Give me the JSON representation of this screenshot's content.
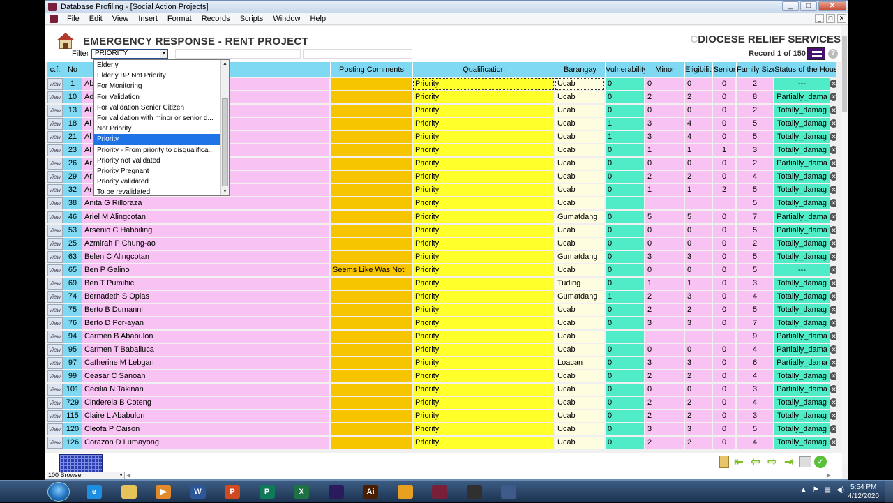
{
  "window": {
    "title": "Database Profiling - [Social Action Projects]",
    "min": "_",
    "max": "□",
    "close": "✕"
  },
  "menu": [
    "File",
    "Edit",
    "View",
    "Insert",
    "Format",
    "Records",
    "Scripts",
    "Window",
    "Help"
  ],
  "header": {
    "project_title": "EMERGENCY RESPONSE - RENT PROJECT",
    "org_prefix": "C",
    "org_name": "DIOCESE RELIEF SERVICES",
    "filter_label": "Filter",
    "filter_value": "PRIORITY",
    "record_info": "Record 1 of 150",
    "help": "?"
  },
  "columns": {
    "cf": "c.f.",
    "no": "No",
    "posting": "Posting Comments",
    "qual": "Qualification",
    "brgy": "Barangay",
    "vul": "Vulnerability",
    "minor": "Minor",
    "elig": "Eligibility",
    "senior": "Senior",
    "family": "Family Size",
    "status": "Status of the House"
  },
  "dropdown": {
    "selected": "Priority",
    "options": [
      "Elderly",
      "Elderly BP Not Priority",
      "For Monitoring",
      "For Validation",
      "For validation Senior Citizen",
      "For validation with minor or senior d...",
      "Not Priority",
      "Priority",
      "Priority - From priority to disqualifica...",
      "Priority not validated",
      "Priority Pregnant",
      "Priority validated",
      "To be revalidated"
    ]
  },
  "view_label": "View",
  "rows": [
    {
      "no": "1",
      "name": "Ab",
      "posting": "",
      "qual": "Priority",
      "brgy": "Ucab",
      "vul": "0",
      "minor": "0",
      "elig": "0",
      "senior": "0",
      "family": "2",
      "status": "---"
    },
    {
      "no": "10",
      "name": "Ad",
      "posting": "",
      "qual": "Priority",
      "brgy": "Ucab",
      "vul": "0",
      "minor": "2",
      "elig": "2",
      "senior": "0",
      "family": "8",
      "status": "Partially_dama"
    },
    {
      "no": "13",
      "name": "Al",
      "posting": "",
      "qual": "Priority",
      "brgy": "Ucab",
      "vul": "0",
      "minor": "0",
      "elig": "0",
      "senior": "0",
      "family": "2",
      "status": "Totally_damag"
    },
    {
      "no": "18",
      "name": "Al",
      "posting": "",
      "qual": "Priority",
      "brgy": "Ucab",
      "vul": "1",
      "minor": "3",
      "elig": "4",
      "senior": "0",
      "family": "5",
      "status": "Totally_damag"
    },
    {
      "no": "21",
      "name": "Al",
      "posting": "",
      "qual": "Priority",
      "brgy": "Ucab",
      "vul": "1",
      "minor": "3",
      "elig": "4",
      "senior": "0",
      "family": "5",
      "status": "Totally_damag"
    },
    {
      "no": "23",
      "name": "Al",
      "posting": "",
      "qual": "Priority",
      "brgy": "Ucab",
      "vul": "0",
      "minor": "1",
      "elig": "1",
      "senior": "1",
      "family": "3",
      "status": "Totally_damag"
    },
    {
      "no": "26",
      "name": "Ar",
      "posting": "",
      "qual": "Priority",
      "brgy": "Ucab",
      "vul": "0",
      "minor": "0",
      "elig": "0",
      "senior": "0",
      "family": "2",
      "status": "Partially_dama"
    },
    {
      "no": "29",
      "name": "Ar",
      "posting": "",
      "qual": "Priority",
      "brgy": "Ucab",
      "vul": "0",
      "minor": "2",
      "elig": "2",
      "senior": "0",
      "family": "4",
      "status": "Totally_damag"
    },
    {
      "no": "32",
      "name": "Ar",
      "posting": "",
      "qual": "Priority",
      "brgy": "Ucab",
      "vul": "0",
      "minor": "1",
      "elig": "1",
      "senior": "2",
      "family": "5",
      "status": "Totally_damag"
    },
    {
      "no": "38",
      "name": "Anita G Rilloraza",
      "posting": "",
      "qual": "Priority",
      "brgy": "Ucab",
      "vul": "",
      "minor": "",
      "elig": "",
      "senior": "",
      "family": "5",
      "status": "Totally_damag"
    },
    {
      "no": "46",
      "name": "Ariel M Alingcotan",
      "posting": "",
      "qual": "Priority",
      "brgy": "Gumatdang",
      "vul": "0",
      "minor": "5",
      "elig": "5",
      "senior": "0",
      "family": "7",
      "status": "Partially_dama"
    },
    {
      "no": "53",
      "name": "Arsenio C Habbiling",
      "posting": "",
      "qual": "Priority",
      "brgy": "Ucab",
      "vul": "0",
      "minor": "0",
      "elig": "0",
      "senior": "0",
      "family": "5",
      "status": "Partially_dama"
    },
    {
      "no": "25",
      "name": "Azmirah P Chung-ao",
      "posting": "",
      "qual": "Priority",
      "brgy": "Ucab",
      "vul": "0",
      "minor": "0",
      "elig": "0",
      "senior": "0",
      "family": "2",
      "status": "Totally_damag"
    },
    {
      "no": "63",
      "name": "Belen C Alingcotan",
      "posting": "",
      "qual": "Priority",
      "brgy": "Gumatdang",
      "vul": "0",
      "minor": "3",
      "elig": "3",
      "senior": "0",
      "family": "5",
      "status": "Totally_damag"
    },
    {
      "no": "65",
      "name": "Ben P Galino",
      "posting": "Seems Like Was Not",
      "qual": "Priority",
      "brgy": "Ucab",
      "vul": "0",
      "minor": "0",
      "elig": "0",
      "senior": "0",
      "family": "5",
      "status": "---"
    },
    {
      "no": "69",
      "name": "Ben T Pumihic",
      "posting": "",
      "qual": "Priority",
      "brgy": "Tuding",
      "vul": "0",
      "minor": "1",
      "elig": "1",
      "senior": "0",
      "family": "3",
      "status": "Totally_damag"
    },
    {
      "no": "74",
      "name": "Bernadeth S Oplas",
      "posting": "",
      "qual": "Priority",
      "brgy": "Gumatdang",
      "vul": "1",
      "minor": "2",
      "elig": "3",
      "senior": "0",
      "family": "4",
      "status": "Totally_damag"
    },
    {
      "no": "75",
      "name": "Berto B Dumanni",
      "posting": "",
      "qual": "Priority",
      "brgy": "Ucab",
      "vul": "0",
      "minor": "2",
      "elig": "2",
      "senior": "0",
      "family": "5",
      "status": "Totally_damag"
    },
    {
      "no": "76",
      "name": "Berto D Por-ayan",
      "posting": "",
      "qual": "Priority",
      "brgy": "Ucab",
      "vul": "0",
      "minor": "3",
      "elig": "3",
      "senior": "0",
      "family": "7",
      "status": "Totally_damag"
    },
    {
      "no": "94",
      "name": "Carmen B Ababulon",
      "posting": "",
      "qual": "Priority",
      "brgy": "Ucab",
      "vul": "",
      "minor": "",
      "elig": "",
      "senior": "",
      "family": "9",
      "status": "Partially_dama"
    },
    {
      "no": "95",
      "name": "Carmen T Baballuca",
      "posting": "",
      "qual": "Priority",
      "brgy": "Ucab",
      "vul": "0",
      "minor": "0",
      "elig": "0",
      "senior": "0",
      "family": "4",
      "status": "Partially_dama"
    },
    {
      "no": "97",
      "name": "Catherine M Lebgan",
      "posting": "",
      "qual": "Priority",
      "brgy": "Loacan",
      "vul": "0",
      "minor": "3",
      "elig": "3",
      "senior": "0",
      "family": "6",
      "status": "Partially_dama"
    },
    {
      "no": "99",
      "name": "Ceasar C Sanoan",
      "posting": "",
      "qual": "Priority",
      "brgy": "Ucab",
      "vul": "0",
      "minor": "2",
      "elig": "2",
      "senior": "0",
      "family": "4",
      "status": "Totally_damag"
    },
    {
      "no": "101",
      "name": "Cecilia N Takinan",
      "posting": "",
      "qual": "Priority",
      "brgy": "Ucab",
      "vul": "0",
      "minor": "0",
      "elig": "0",
      "senior": "0",
      "family": "3",
      "status": "Partially_dama"
    },
    {
      "no": "729",
      "name": "Cinderela B Coteng",
      "posting": "",
      "qual": "Priority",
      "brgy": "Ucab",
      "vul": "0",
      "minor": "2",
      "elig": "2",
      "senior": "0",
      "family": "4",
      "status": "Totally_damag"
    },
    {
      "no": "115",
      "name": "Claire L Ababulon",
      "posting": "",
      "qual": "Priority",
      "brgy": "Ucab",
      "vul": "0",
      "minor": "2",
      "elig": "2",
      "senior": "0",
      "family": "3",
      "status": "Totally_damag"
    },
    {
      "no": "120",
      "name": "Cleofa P Caison",
      "posting": "",
      "qual": "Priority",
      "brgy": "Ucab",
      "vul": "0",
      "minor": "3",
      "elig": "3",
      "senior": "0",
      "family": "5",
      "status": "Totally_damag"
    },
    {
      "no": "126",
      "name": "Corazon D Lumayong",
      "posting": "",
      "qual": "Priority",
      "brgy": "Ucab",
      "vul": "0",
      "minor": "2",
      "elig": "2",
      "senior": "0",
      "family": "4",
      "status": "Totally_damag"
    }
  ],
  "footer": {
    "zoom": "100",
    "mode": "Browse"
  },
  "taskbar": {
    "apps": [
      {
        "name": "internet-explorer",
        "label": "e",
        "color": "#1e8fe0"
      },
      {
        "name": "file-explorer",
        "label": "",
        "color": "#e6c35a"
      },
      {
        "name": "media-player",
        "label": "▶",
        "color": "#e08a2a"
      },
      {
        "name": "word",
        "label": "W",
        "color": "#2b5797"
      },
      {
        "name": "powerpoint",
        "label": "P",
        "color": "#d04a20"
      },
      {
        "name": "publisher",
        "label": "P",
        "color": "#0e7a5a"
      },
      {
        "name": "excel",
        "label": "X",
        "color": "#1e7145"
      },
      {
        "name": "premiere",
        "label": "",
        "color": "#2a1a5e"
      },
      {
        "name": "illustrator",
        "label": "Ai",
        "color": "#4a1f00"
      },
      {
        "name": "chrome",
        "label": "",
        "color": "#e8a020"
      },
      {
        "name": "filemaker",
        "label": "",
        "color": "#7a1f3a"
      },
      {
        "name": "obs",
        "label": "",
        "color": "#303030"
      },
      {
        "name": "network-app",
        "label": "",
        "color": "#3d5a8a"
      }
    ],
    "time": "5:54 PM",
    "date": "4/12/2020"
  }
}
